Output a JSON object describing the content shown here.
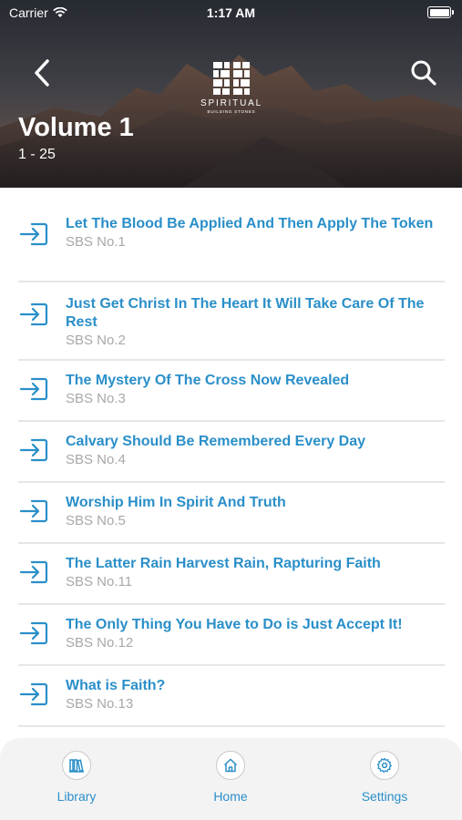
{
  "status_bar": {
    "carrier": "Carrier",
    "time": "1:17 AM"
  },
  "header": {
    "volume_title": "Volume 1",
    "volume_range": "1 - 25",
    "logo_text": "SPIRITUAL",
    "logo_sub": "BUILDING STONES"
  },
  "items": [
    {
      "title": "Let The Blood Be Applied And Then Apply The Token",
      "sub": "SBS No.1"
    },
    {
      "title": "Just Get Christ In The Heart It Will Take Care Of The Rest",
      "sub": "SBS No.2"
    },
    {
      "title": "The Mystery Of The Cross Now Revealed",
      "sub": "SBS No.3"
    },
    {
      "title": "Calvary Should Be Remembered Every Day",
      "sub": "SBS No.4"
    },
    {
      "title": "Worship Him In Spirit And Truth",
      "sub": "SBS No.5"
    },
    {
      "title": "The Latter Rain  Harvest Rain, Rapturing Faith",
      "sub": "SBS No.11"
    },
    {
      "title": "The Only Thing You Have to Do is Just Accept It!",
      "sub": "SBS No.12"
    },
    {
      "title": "What is Faith?",
      "sub": "SBS No.13"
    }
  ],
  "tabs": {
    "library": "Library",
    "home": "Home",
    "settings": "Settings"
  },
  "colors": {
    "accent": "#2a8fc9",
    "subtitle": "#a8a8a8",
    "divider": "#e6e6e6",
    "tabbar": "#f3f3f3"
  }
}
